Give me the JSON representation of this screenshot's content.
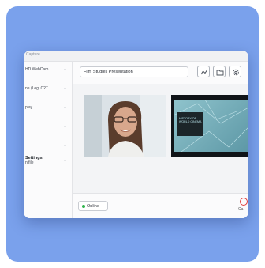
{
  "window": {
    "title": "Capture"
  },
  "sidebar": {
    "items": [
      {
        "label": "HD WebCam"
      },
      {
        "label": "ne (Logi C27..."
      },
      {
        "label": "play"
      },
      {
        "label": ""
      },
      {
        "label": ""
      }
    ],
    "settings": {
      "label": "Settings",
      "sub": "n file"
    }
  },
  "topbar": {
    "name_value": "Film Studies Presentation",
    "icons": [
      "activity-chart-icon",
      "folder-icon",
      "settings-gear-icon"
    ]
  },
  "slide": {
    "text": "HISTORY OF WORLD CINEMA"
  },
  "footer": {
    "status": "Online",
    "end_label": "Ca"
  },
  "colors": {
    "background": "#7aa1ec",
    "online": "#2eb34a",
    "end": "#e03a3a"
  }
}
